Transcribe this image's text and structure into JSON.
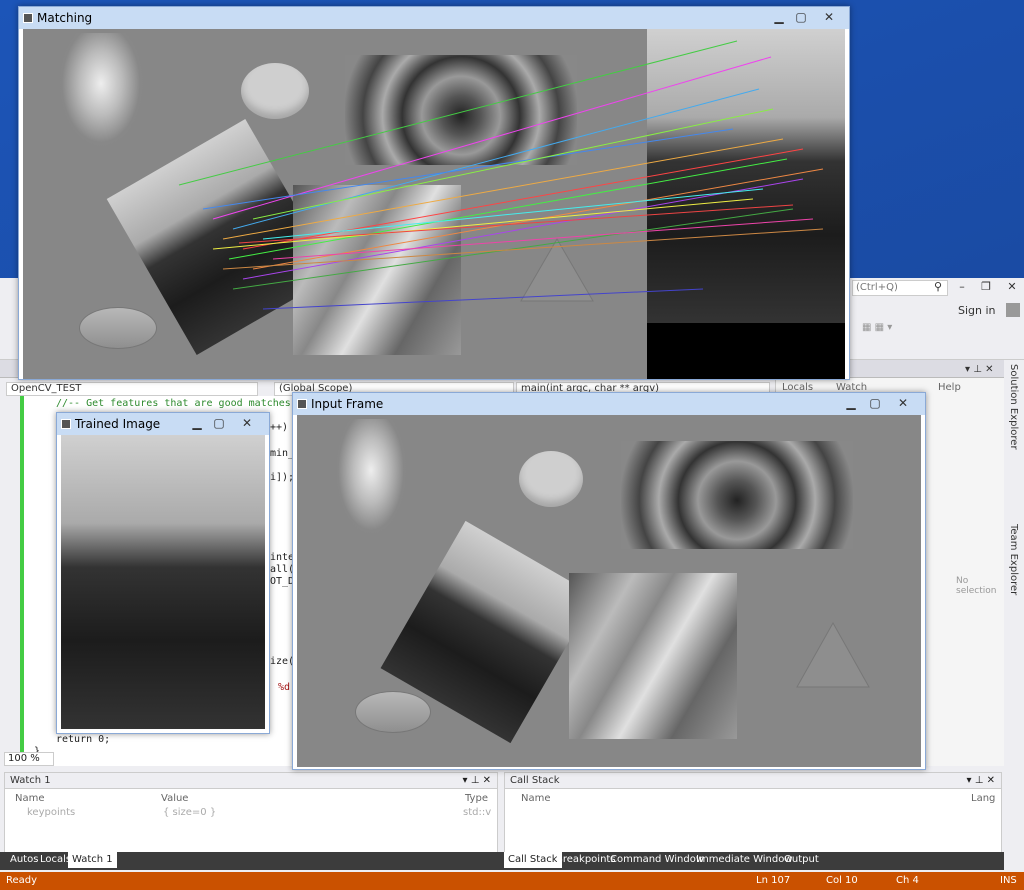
{
  "desktop": {
    "background": "#1c55b8"
  },
  "vs": {
    "search_placeholder": "(Ctrl+Q)",
    "sign_in": "Sign in",
    "scope_combo_1": "OpenCV_TEST",
    "scope_combo_2": "(Global Scope)",
    "scope_combo_3": "main(int argc, char ** argv)",
    "locals_label": "Locals",
    "watch_label": "Watch",
    "help_label": "Help",
    "no_selection": "No selection",
    "zoom": "100 %",
    "code": {
      "comment_line": "//-- Get features that are good matches",
      "frag1": "++)",
      "frag2": "min_",
      "frag3": "i]);",
      "frag4": "inte",
      "frag5": "all(",
      "frag6": "OT_D",
      "frag7": "ize(",
      "frag8": "%d",
      "return_line": "return 0;",
      "close_brace": "}"
    },
    "solution_explorer": "Solution Explorer",
    "team_explorer": "Team Explorer",
    "watch1": {
      "title": "Watch 1",
      "col_name": "Name",
      "col_value": "Value",
      "col_type": "Type",
      "row_name": "keypoints",
      "row_value": "{ size=0 }",
      "row_type": "std::v"
    },
    "callstack": {
      "title": "Call Stack",
      "col_name": "Name",
      "col_lang": "Lang"
    },
    "left_tabs": [
      "Autos",
      "Locals",
      "Watch 1"
    ],
    "right_tabs": [
      "Call Stack",
      "Breakpoints",
      "Command Window",
      "Immediate Window",
      "Output"
    ],
    "status": {
      "ready": "Ready",
      "line": "Ln 107",
      "col": "Col 10",
      "ch": "Ch 4",
      "mode": "INS"
    }
  },
  "windows": {
    "matching": {
      "title": "Matching"
    },
    "input_frame": {
      "title": "Input Frame"
    },
    "trained_image": {
      "title": "Trained Image"
    }
  },
  "colors": {
    "status_bar": "#ca5100",
    "canvas_gray": "#878787",
    "title_bar": "#c8dcf4"
  }
}
